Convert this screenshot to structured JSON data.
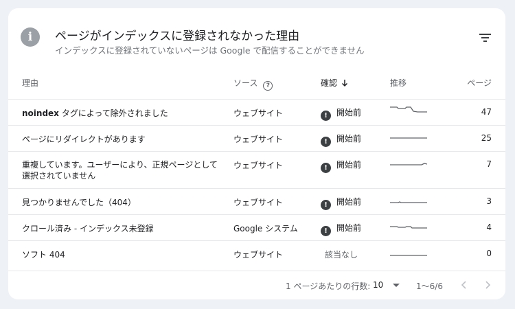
{
  "header": {
    "title": "ページがインデックスに登録されなかった理由",
    "subtitle": "インデックスに登録されていないページは Google で配信することができません",
    "info_icon": "info-icon",
    "filter_icon": "filter-icon"
  },
  "columns": {
    "reason": "理由",
    "source": "ソース",
    "verify": "確認",
    "trend": "推移",
    "pages": "ページ"
  },
  "rows": [
    {
      "reason_bold": "noindex",
      "reason_rest": " タグによって除外されました",
      "source": "ウェブサイト",
      "status": "開始前",
      "pages": "47"
    },
    {
      "reason_line1": "ページにリダイレクトがあります",
      "source": "ウェブサイト",
      "status": "開始前",
      "pages": "25"
    },
    {
      "reason_line1": "重複しています。ユーザーにより、正規ページとして",
      "reason_line2": "選択されていません",
      "source": "ウェブサイト",
      "status": "開始前",
      "pages": "7"
    },
    {
      "reason_line1": "見つかりませんでした（404）",
      "source": "ウェブサイト",
      "status": "開始前",
      "pages": "3"
    },
    {
      "reason_line1": "クロール済み - インデックス未登録",
      "source": "Google システム",
      "status": "開始前",
      "pages": "4"
    },
    {
      "reason_line1": "ソフト 404",
      "source": "ウェブサイト",
      "status": "該当なし",
      "pages": "0"
    }
  ],
  "footer": {
    "rows_per_page_label": "1 ページあたりの行数:",
    "rows_per_page_value": "10",
    "range": "1〜6/6"
  },
  "colors": {
    "accent": "#3c4043",
    "muted": "#5f6368",
    "divider": "#e6e8eb"
  }
}
